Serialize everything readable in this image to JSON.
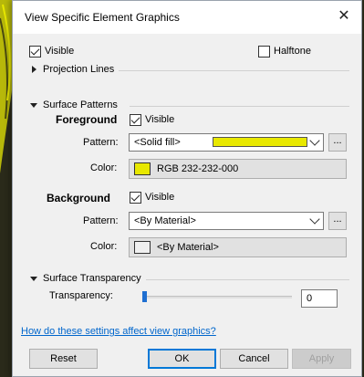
{
  "dialog": {
    "title": "View Specific Element Graphics"
  },
  "general": {
    "visible_label": "Visible",
    "halftone_label": "Halftone"
  },
  "projection_lines": {
    "label": "Projection Lines"
  },
  "surface_patterns": {
    "label": "Surface Patterns",
    "foreground": {
      "heading": "Foreground",
      "visible_label": "Visible",
      "pattern_label": "Pattern:",
      "pattern_value": "<Solid fill>",
      "color_label": "Color:",
      "color_value": "RGB 232-232-000",
      "color_hex": "#e8e800"
    },
    "background": {
      "heading": "Background",
      "visible_label": "Visible",
      "pattern_label": "Pattern:",
      "pattern_value": "<By Material>",
      "color_label": "Color:",
      "color_value": "<By Material>",
      "color_hex": "#f0f0f0"
    },
    "more_button": "..."
  },
  "surface_transparency": {
    "label": "Surface Transparency",
    "transparency_label": "Transparency:",
    "transparency_value": "0"
  },
  "help_link": "How do these settings affect view graphics?",
  "buttons": {
    "reset": "Reset",
    "ok": "OK",
    "cancel": "Cancel",
    "apply": "Apply"
  }
}
